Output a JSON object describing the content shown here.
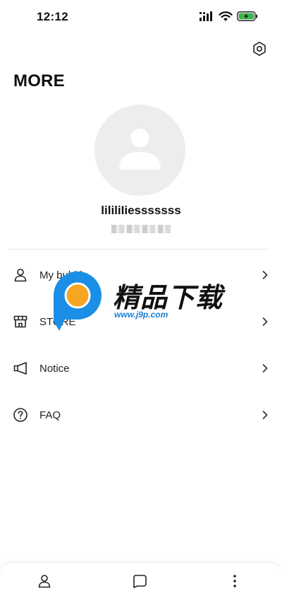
{
  "status_bar": {
    "time": "12:12",
    "icons": [
      "signal-icon",
      "wifi-icon",
      "battery-charging-icon"
    ],
    "battery_color": "#3bb54a"
  },
  "header": {
    "title": "MORE",
    "settings_icon": "gear-icon"
  },
  "profile": {
    "username": "lililiIiesssssss",
    "avatar_icon": "person-icon",
    "avatar_bg": "#ededed"
  },
  "menu": {
    "items": [
      {
        "label": "My bubble",
        "icon": "person-icon"
      },
      {
        "label": "STORE",
        "icon": "store-icon"
      },
      {
        "label": "Notice",
        "icon": "megaphone-icon"
      },
      {
        "label": "FAQ",
        "icon": "question-icon"
      }
    ]
  },
  "watermark": {
    "title": "精品下载",
    "url": "www.j9p.com",
    "colors": {
      "blue": "#1b8fe6",
      "orange": "#f6a623"
    }
  },
  "bottom_nav": {
    "items": [
      "profile-icon",
      "chat-icon",
      "more-icon"
    ]
  }
}
